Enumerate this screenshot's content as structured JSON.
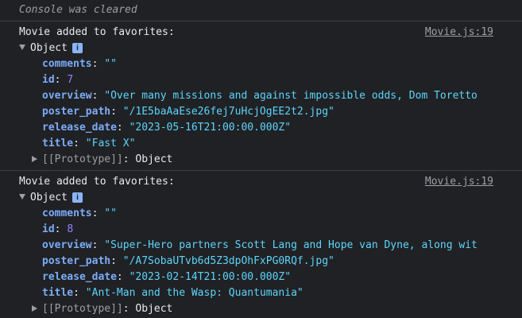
{
  "console": {
    "cleared_message": "Console was cleared"
  },
  "entries": [
    {
      "message": "Movie added to favorites:",
      "source": "Movie.js:19",
      "object_label": "Object",
      "info_icon": "i",
      "props": {
        "comments": {
          "key": "comments",
          "value": "\"\""
        },
        "id": {
          "key": "id",
          "value": "7"
        },
        "overview": {
          "key": "overview",
          "value": "\"Over many missions and against impossible odds, Dom Toretto"
        },
        "poster_path": {
          "key": "poster_path",
          "value": "\"/1E5baAaEse26fej7uHcjOgEE2t2.jpg\""
        },
        "release_date": {
          "key": "release_date",
          "value": "\"2023-05-16T21:00:00.000Z\""
        },
        "title": {
          "key": "title",
          "value": "\"Fast X\""
        }
      },
      "prototype": {
        "key": "[[Prototype]]",
        "value": "Object"
      }
    },
    {
      "message": "Movie added to favorites:",
      "source": "Movie.js:19",
      "object_label": "Object",
      "info_icon": "i",
      "props": {
        "comments": {
          "key": "comments",
          "value": "\"\""
        },
        "id": {
          "key": "id",
          "value": "8"
        },
        "overview": {
          "key": "overview",
          "value": "\"Super-Hero partners Scott Lang and Hope van Dyne, along wit"
        },
        "poster_path": {
          "key": "poster_path",
          "value": "\"/A7SobaUTvb6d5Z3dpOhFxPG0RQf.jpg\""
        },
        "release_date": {
          "key": "release_date",
          "value": "\"2023-02-14T21:00:00.000Z\""
        },
        "title": {
          "key": "title",
          "value": "\"Ant-Man and the Wasp: Quantumania\""
        }
      },
      "prototype": {
        "key": "[[Prototype]]",
        "value": "Object"
      }
    }
  ],
  "colors": {
    "background": "#202124",
    "key": "#7cacf8",
    "string": "#5cd5fb",
    "number": "#9980ff",
    "muted": "#9aa0a6"
  }
}
